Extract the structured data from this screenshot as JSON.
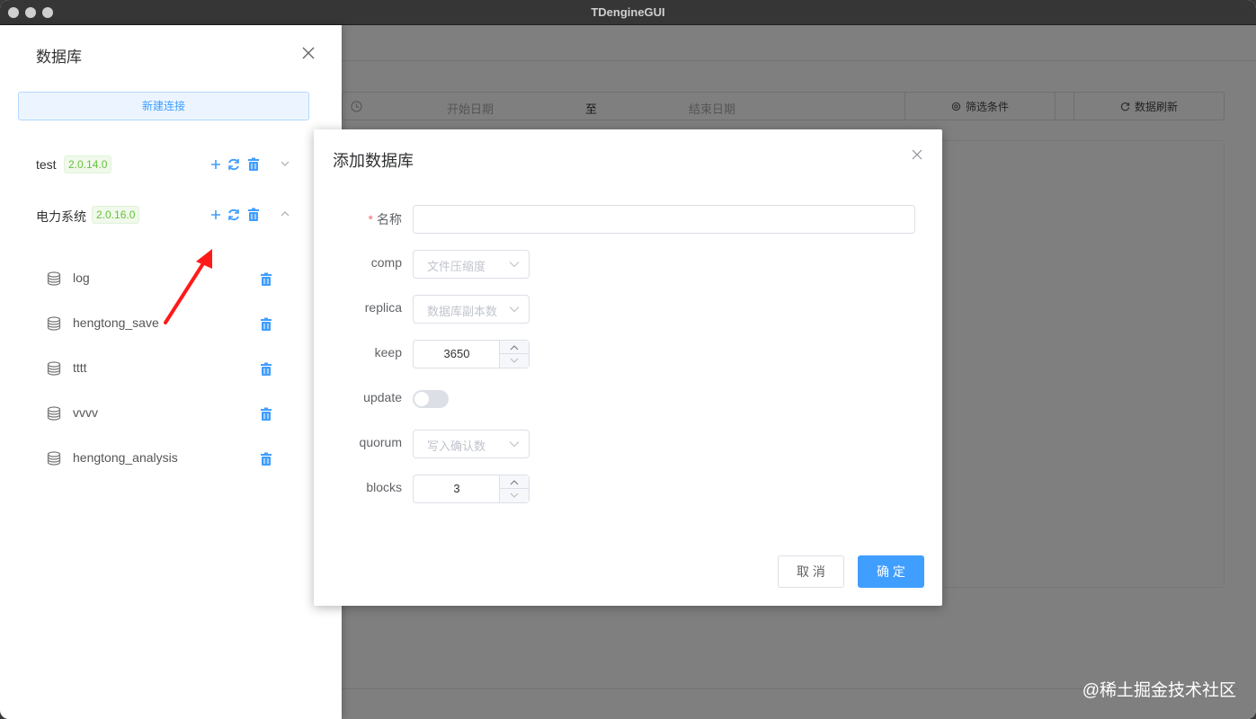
{
  "window": {
    "title": "TDengineGUI"
  },
  "filter": {
    "start_placeholder": "开始日期",
    "separator": "至",
    "end_placeholder": "结束日期",
    "filter_button": "筛选条件",
    "refresh_button": "数据刷新"
  },
  "drawer": {
    "title": "数据库",
    "new_connection": "新建连接",
    "connections": [
      {
        "name": "test",
        "version": "2.0.14.0",
        "expanded": false
      },
      {
        "name": "电力系统",
        "version": "2.0.16.0",
        "expanded": true
      }
    ],
    "databases": [
      "log",
      "hengtong_save",
      "tttt",
      "vvvv",
      "hengtong_analysis"
    ]
  },
  "dialog": {
    "title": "添加数据库",
    "fields": {
      "name_label": "名称",
      "name_value": "",
      "comp_label": "comp",
      "comp_placeholder": "文件压缩度",
      "replica_label": "replica",
      "replica_placeholder": "数据库副本数",
      "keep_label": "keep",
      "keep_value": "3650",
      "update_label": "update",
      "update_on": false,
      "quorum_label": "quorum",
      "quorum_placeholder": "写入确认数",
      "blocks_label": "blocks",
      "blocks_value": "3"
    },
    "cancel_button": "取 消",
    "confirm_button": "确 定"
  },
  "watermark": "@稀土掘金技术社区",
  "colors": {
    "primary": "#409eff",
    "success": "#67c23a",
    "danger": "#f56c6c",
    "annotation_arrow": "#ff1a1a"
  }
}
